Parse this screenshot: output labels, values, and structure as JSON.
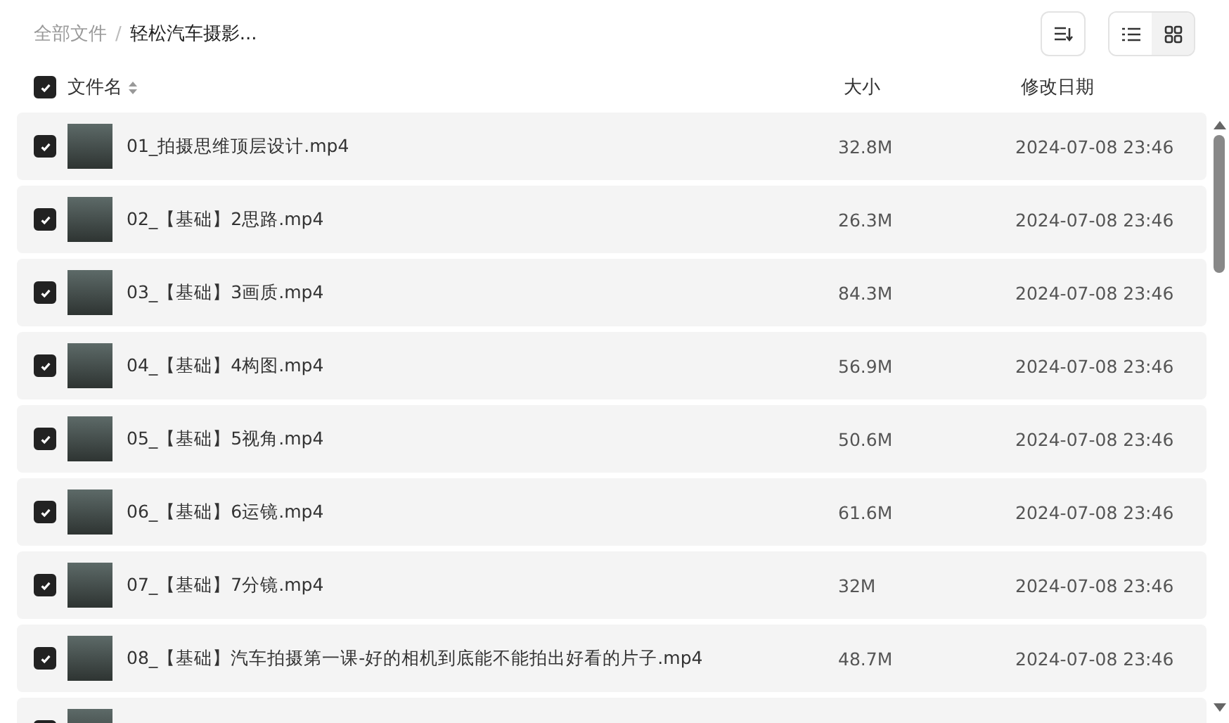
{
  "breadcrumb_separator": "/",
  "breadcrumb": [
    {
      "label": "全部文件",
      "current": false
    },
    {
      "label": "轻松汽车摄影...",
      "current": true
    }
  ],
  "view_toggle": [
    {
      "kind": "list",
      "selected": true
    },
    {
      "kind": "grid",
      "selected": false
    }
  ],
  "header": {
    "select_all": true,
    "columns": [
      "文件名",
      "大小",
      "修改日期"
    ]
  },
  "rows": [
    {
      "checked": true,
      "name": "01_拍摄思维顶层设计.mp4",
      "size": "32.8M",
      "date": "2024-07-08 23:46"
    },
    {
      "checked": true,
      "name": "02_【基础】2思路.mp4",
      "size": "26.3M",
      "date": "2024-07-08 23:46"
    },
    {
      "checked": true,
      "name": "03_【基础】3画质.mp4",
      "size": "84.3M",
      "date": "2024-07-08 23:46"
    },
    {
      "checked": true,
      "name": "04_【基础】4构图.mp4",
      "size": "56.9M",
      "date": "2024-07-08 23:46"
    },
    {
      "checked": true,
      "name": "05_【基础】5视角.mp4",
      "size": "50.6M",
      "date": "2024-07-08 23:46"
    },
    {
      "checked": true,
      "name": "06_【基础】6运镜.mp4",
      "size": "61.6M",
      "date": "2024-07-08 23:46"
    },
    {
      "checked": true,
      "name": "07_【基础】7分镜.mp4",
      "size": "32M",
      "date": "2024-07-08 23:46"
    },
    {
      "checked": true,
      "name": "08_【基础】汽车拍摄第一课-好的相机到底能不能拍出好看的片子.mp4",
      "size": "48.7M",
      "date": "2024-07-08 23:46"
    },
    {
      "checked": true
    }
  ]
}
